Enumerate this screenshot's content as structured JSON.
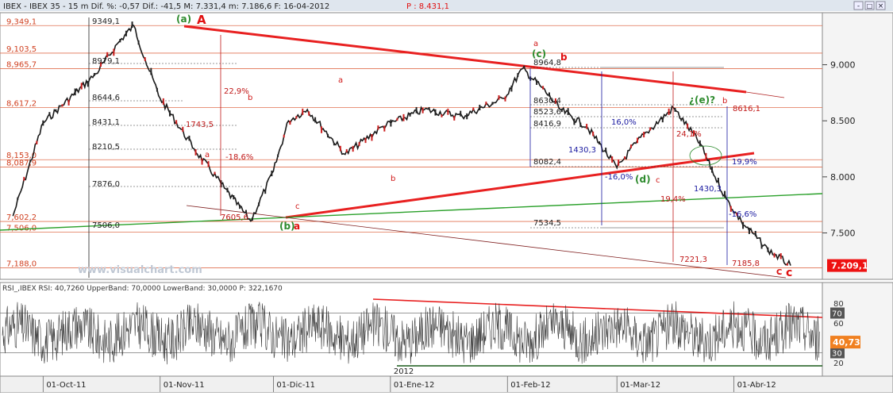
{
  "window": {
    "title_text": "IBEX - IBEX 35 - 15 m Dif. %: -0,57 Dif.: -41,5 M: 7.331,4 m: 7.186,6 F: 16-04-2012",
    "price_text": "P : 8.431,1",
    "buttons": [
      "-",
      "□",
      "×"
    ]
  },
  "watermark": "www.visualchart.com",
  "chart_data": [
    {
      "type": "line",
      "name": "IBEX 15 m",
      "ylim": [
        7100,
        9450
      ],
      "y_ticks": [
        7500,
        8000,
        8500,
        9000
      ],
      "y_tick_labels": [
        "7.500",
        "8.000",
        "8.500",
        "9.000"
      ],
      "last_price": 7209.1,
      "last_price_label": "7.209,1",
      "x": [
        "2011-09-23",
        "2011-10-01",
        "2011-10-15",
        "2011-10-21",
        "2011-10-25",
        "2011-10-28",
        "2011-11-01",
        "2011-11-10",
        "2011-11-18",
        "2011-11-25",
        "2011-12-01",
        "2011-12-05",
        "2011-12-10",
        "2011-12-20",
        "2011-12-30",
        "2012-01-10",
        "2012-01-20",
        "2012-01-31",
        "2012-02-05",
        "2012-02-10",
        "2012-02-15",
        "2012-02-22",
        "2012-03-01",
        "2012-03-06",
        "2012-03-09",
        "2012-03-16",
        "2012-03-23",
        "2012-03-27",
        "2012-03-30",
        "2012-04-03",
        "2012-04-10",
        "2012-04-16"
      ],
      "y": [
        7650,
        8480,
        8920,
        9200,
        9349.1,
        9050,
        8700,
        8250,
        7900,
        7605.6,
        8050,
        8500,
        8600,
        8200,
        8450,
        8600,
        8540,
        8700,
        8964.8,
        8800,
        8600,
        8450,
        8080,
        8300,
        8400,
        8616.1,
        8300,
        8000,
        7800,
        7600,
        7350,
        7209.1
      ],
      "price_levels": [
        {
          "value": 9349.1,
          "label": "9,349,1"
        },
        {
          "value": 9103.5,
          "label": "9,103,5"
        },
        {
          "value": 8965.7,
          "label": "8,965,7"
        },
        {
          "value": 8617.2,
          "label": "8,617,2"
        },
        {
          "value": 8153.0,
          "label": "8,153,0"
        },
        {
          "value": 8087.9,
          "label": "8,087,9"
        },
        {
          "value": 7602.2,
          "label": "7,602,2"
        },
        {
          "value": 7506.0,
          "label": "7,506,0"
        },
        {
          "value": 7188.0,
          "label": "7,188,0"
        }
      ],
      "retracement_labels": [
        {
          "value": 9349.1,
          "label": "9349,1"
        },
        {
          "value": 8979.1,
          "label": "8979,1"
        },
        {
          "value": 8644.6,
          "label": "8644,6"
        },
        {
          "value": 8431.1,
          "label": "8431,1"
        },
        {
          "value": 8210.5,
          "label": "8210,5"
        },
        {
          "value": 7876.0,
          "label": "7876,0"
        },
        {
          "value": 7506.0,
          "label": "7506,0"
        },
        {
          "value": 8964.8,
          "label": "8964,8"
        },
        {
          "value": 8630.4,
          "label": "8630,4"
        },
        {
          "value": 8523.6,
          "label": "8523,6"
        },
        {
          "value": 8416.9,
          "label": "8416,9"
        },
        {
          "value": 8082.4,
          "label": "8082,4"
        },
        {
          "value": 7534.5,
          "label": "7534,5"
        },
        {
          "value": 8616.1,
          "label": "8616,1"
        },
        {
          "value": 7221.3,
          "label": "7221,3"
        },
        {
          "value": 7185.8,
          "label": "7185,8"
        },
        {
          "value": 7605.6,
          "label": "7605,6"
        },
        {
          "value": 1430.3,
          "label": "1430,3"
        },
        {
          "value": 1430.3,
          "label": "1430,3"
        },
        {
          "value": 1743.5,
          "label": "1743,5"
        }
      ],
      "percent_labels": [
        "22,9%",
        "-18,6%",
        "16,0%",
        "-16,0%",
        "24,1%",
        "19,9%",
        "19,4%",
        "-16,6%"
      ],
      "wave_labels": [
        {
          "text": "(a)",
          "color": "#2e8b2e"
        },
        {
          "text": "A",
          "color": "#e01010"
        },
        {
          "text": "(b)",
          "color": "#2e8b2e"
        },
        {
          "text": "a",
          "color": "#e01010"
        },
        {
          "text": "(c)",
          "color": "#2e8b2e"
        },
        {
          "text": "b",
          "color": "#e01010"
        },
        {
          "text": "(d)",
          "color": "#2e8b2e"
        },
        {
          "text": "¿(e)?",
          "color": "#2e8b2e"
        },
        {
          "text": "c",
          "color": "#e01010"
        },
        {
          "text": "C",
          "color": "#e01010"
        }
      ],
      "small_letters": [
        "a",
        "b",
        "a",
        "c",
        "b",
        "a",
        "c",
        "c",
        "b"
      ]
    },
    {
      "type": "line",
      "name": "RSI IBEX",
      "header_text": "RSI_,IBEX RSI: 40,7260 UpperBand: 70,0000 LowerBand: 30,0000 P: 322,1670",
      "ylim": [
        8,
        88
      ],
      "y_ticks": [
        20,
        40,
        60,
        80
      ],
      "y_tick_labels": [
        "20",
        "40",
        "60",
        "80"
      ],
      "upper_band": 70,
      "lower_band": 30,
      "upper_band_label": "70",
      "lower_band_label": "30",
      "last_value": 40.73,
      "last_value_label": "40,73",
      "x_tick_labels": [
        "01-Oct-11",
        "01-Nov-11",
        "01-Dic-11",
        "01-Ene-12",
        "01-Feb-12",
        "01-Mar-12",
        "01-Abr-12"
      ],
      "year_label": "2012"
    }
  ],
  "colors": {
    "price_line": "#1a1a1a",
    "bear_candle": "#cc2020",
    "trend_red": "#e82020",
    "trend_green": "#2aa02a",
    "level_line": "#e07050",
    "fib_blue": "#1a1aa0",
    "last_price_bg": "#ee1111",
    "rsi_last_bg": "#f08020",
    "band_label_bg": "#555555"
  }
}
